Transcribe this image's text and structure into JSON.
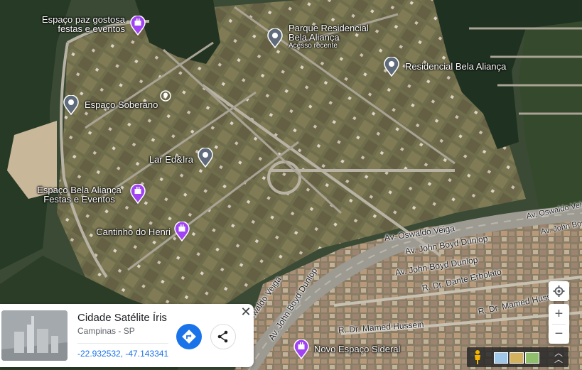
{
  "map": {
    "places": [
      {
        "label": "Espaço paz gostosa\nfestas e eventos",
        "type": "event-venue"
      },
      {
        "label": "Parque Residencial\nBela Aliança",
        "sublabel": "Acesso recente",
        "type": "place"
      },
      {
        "label": "Residencial Bela Aliança",
        "type": "place"
      },
      {
        "label": "Espaço Soberano",
        "type": "place"
      },
      {
        "label": "Lar Ed&Ira",
        "type": "place"
      },
      {
        "label": "Espaço Bela Aliança\nFestas e Eventos",
        "type": "event-venue"
      },
      {
        "label": "Cantinho do Henri",
        "type": "event-venue"
      },
      {
        "label": "Novo Espaço Sideral",
        "type": "event-venue"
      }
    ],
    "streets": [
      "Av. Oswaldo Veiga",
      "Av. Oswaldo Veiga",
      "Av. John Boyd Dunlop",
      "Av. John Boyd Dunlop",
      "Av. John Boyd Dunlop",
      "Av. John Boyd Dunlop",
      "R. Dr. Dante Erbolato",
      "R. Dr. Mamed Hussein",
      "R. Dr. Mamed Hussein",
      "Oswaldo Veiga"
    ]
  },
  "place_card": {
    "title": "Cidade Satélite Íris",
    "subtitle": "Campinas - SP",
    "coordinates": "-22.932532, -47.143341"
  },
  "icons": {
    "directions": "directions-icon",
    "share": "share-icon",
    "close": "close-icon",
    "location": "my-location-icon",
    "zoom_in": "zoom-in-icon",
    "zoom_out": "zoom-out-icon",
    "pegman": "pegman-icon",
    "expand": "expand-icon"
  },
  "colors": {
    "accent": "#1a73e8",
    "event_pin": "#a142f4",
    "place_pin": "#5f6b7a"
  }
}
